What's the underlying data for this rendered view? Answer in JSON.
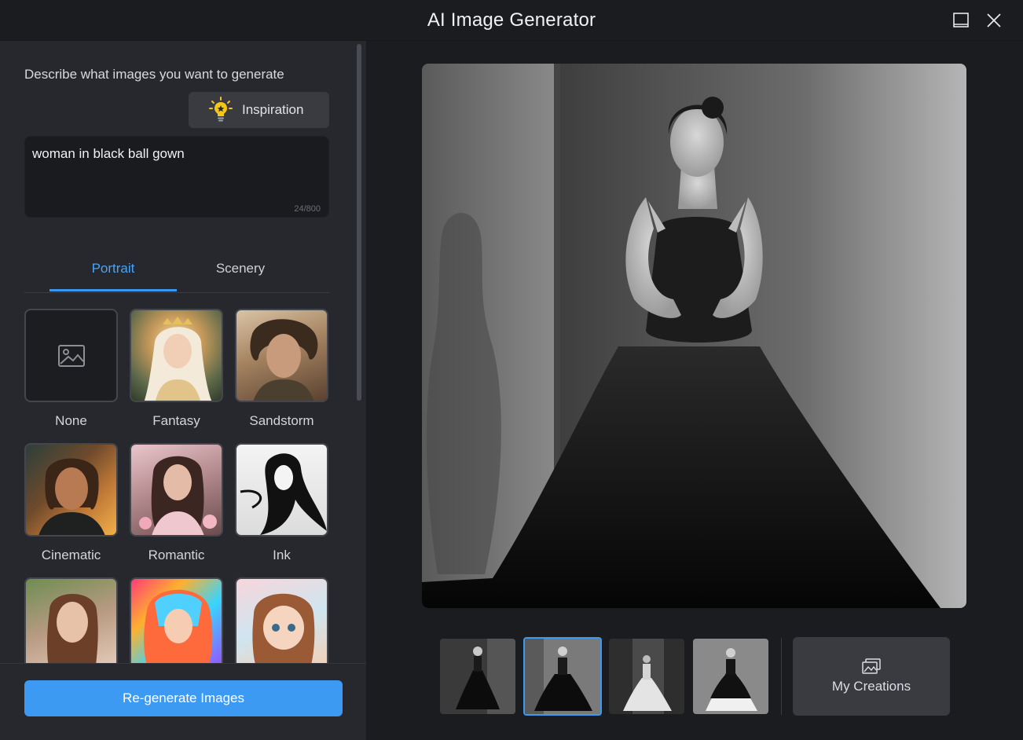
{
  "window": {
    "title": "AI Image Generator"
  },
  "prompt": {
    "label": "Describe what images you want to generate",
    "inspiration_label": "Inspiration",
    "value": "woman in black ball gown",
    "counter": "24/800"
  },
  "tabs": [
    {
      "label": "Portrait",
      "active": true
    },
    {
      "label": "Scenery",
      "active": false
    }
  ],
  "styles": [
    {
      "label": "None"
    },
    {
      "label": "Fantasy"
    },
    {
      "label": "Sandstorm"
    },
    {
      "label": "Cinematic"
    },
    {
      "label": "Romantic"
    },
    {
      "label": "Ink"
    },
    {
      "label": ""
    },
    {
      "label": ""
    },
    {
      "label": ""
    }
  ],
  "actions": {
    "regenerate_label": "Re-generate Images"
  },
  "gallery": {
    "selected_index": 1,
    "my_creations_label": "My Creations"
  },
  "colors": {
    "accent": "#3d9af2",
    "panel": "#27282d",
    "background": "#1b1c20"
  }
}
